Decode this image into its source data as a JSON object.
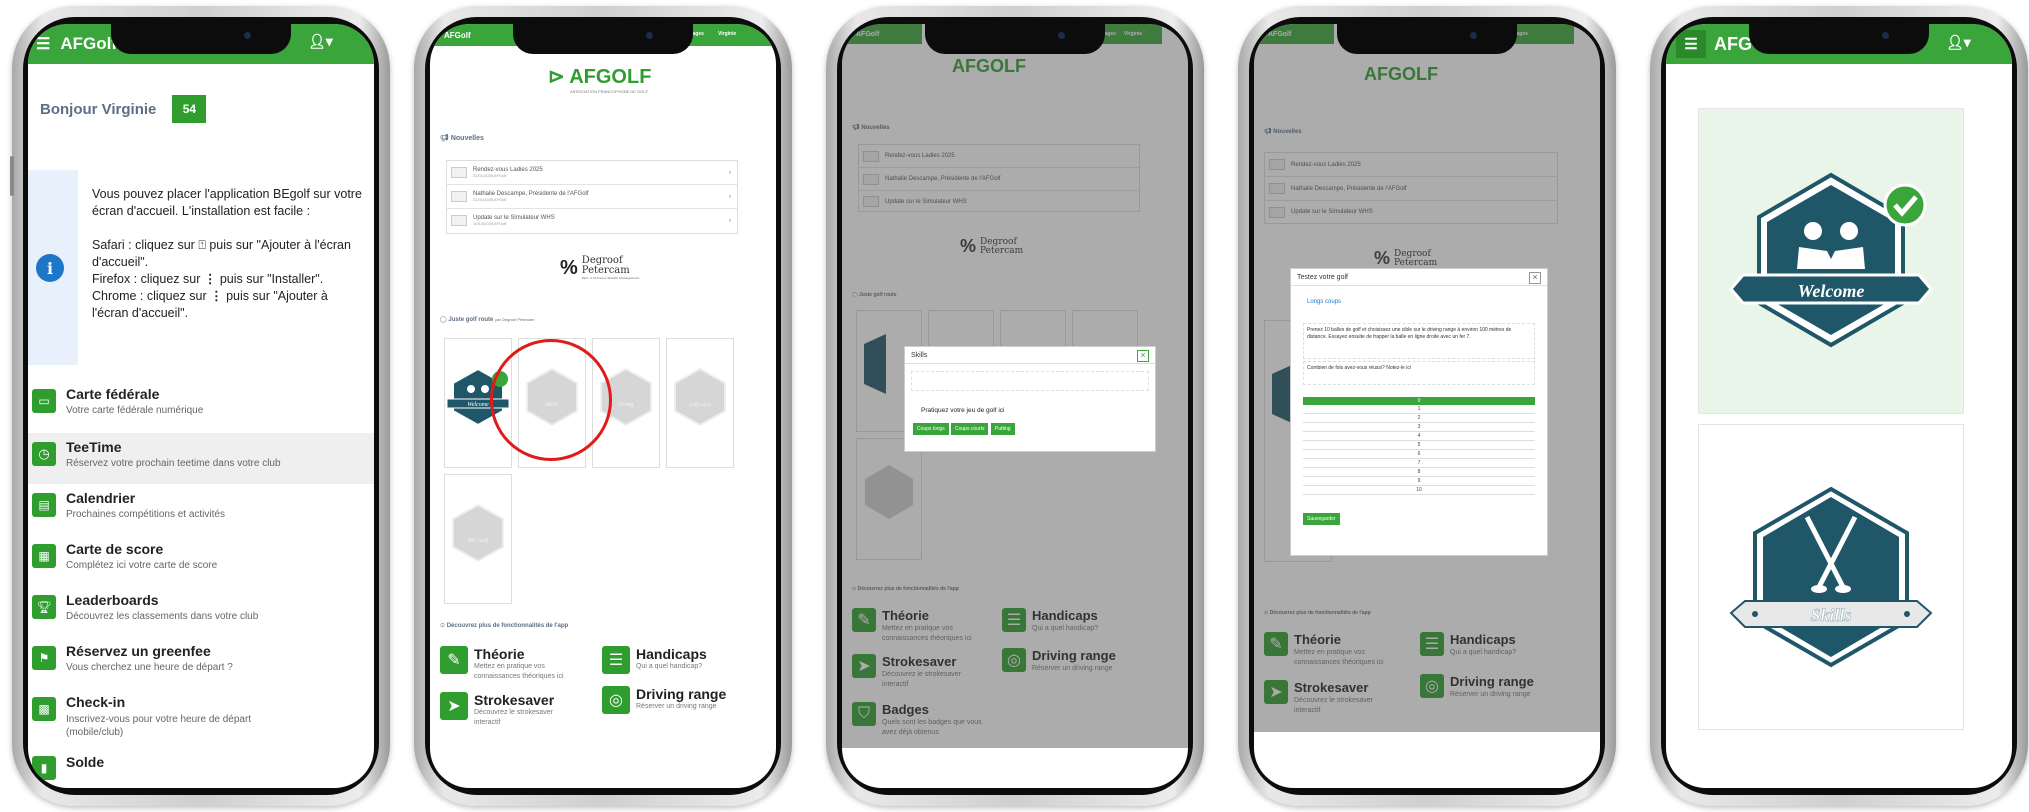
{
  "screen1": {
    "app_name": "AFGolf",
    "greeting": "Bonjour Virginie",
    "badge_number": "54",
    "info_text": [
      "Vous pouvez placer l'application BEgolf sur votre écran d'accueil. L'installation est facile :",
      "Safari : cliquez sur",
      "puis sur \"Ajouter à l'écran d'accueil\".",
      "Firefox : cliquez sur",
      "puis sur \"Installer\".",
      "Chrome : cliquez sur",
      "puis sur \"Ajouter à l'écran d'accueil\"."
    ],
    "menu": [
      {
        "title": "Carte fédérale",
        "subtitle": "Votre carte fédérale numérique",
        "icon": "id-card-icon"
      },
      {
        "title": "TeeTime",
        "subtitle": "Réservez votre prochain teetime dans votre club",
        "icon": "clock-icon"
      },
      {
        "title": "Calendrier",
        "subtitle": "Prochaines compétitions et activités",
        "icon": "calendar-icon"
      },
      {
        "title": "Carte de score",
        "subtitle": "Complétez ici votre carte de score",
        "icon": "scorecard-icon"
      },
      {
        "title": "Leaderboards",
        "subtitle": "Découvrez les classements dans votre club",
        "icon": "trophy-icon"
      },
      {
        "title": "Réservez un greenfee",
        "subtitle": "Vous cherchez une heure de départ ?",
        "icon": "flag-icon"
      },
      {
        "title": "Check-in",
        "subtitle": "Inscrivez-vous pour votre heure de départ (mobile/club)",
        "icon": "qr-icon"
      },
      {
        "title": "Solde",
        "subtitle": "",
        "icon": "wallet-icon"
      }
    ]
  },
  "screen2": {
    "header_brand": "AFGolf",
    "header_links": [
      "Messages",
      "Virginie"
    ],
    "logo_text": "AFGOLF",
    "logo_tagline": "ASSOCIATION FRANCOPHONE DE GOLF",
    "news_heading": "Nouvelles",
    "news": [
      {
        "title": "Rendez-vous Ladies 2025",
        "meta": "21/01/2025 AFGolf"
      },
      {
        "title": "Nathalie Descampe, Présidente de l'AFGolf",
        "meta": "21/01/2025 AFGolf"
      },
      {
        "title": "Update sur le Simulateur WHS",
        "meta": "10/10/2024 AFGolf"
      }
    ],
    "sponsor_name": [
      "Degroof",
      "Petercam"
    ],
    "sponsor_tagline": "Part of Indosuez Wealth Management",
    "badges_heading": "Juste golf route",
    "badges_sub": "par Degroof Petercam",
    "badges": [
      "Welcome",
      "Skills",
      "Swing",
      "Golfcourse",
      "Bel Golf"
    ],
    "discover_heading": "Découvrez plus de fonctionnalités de l'app",
    "features": [
      {
        "title": "Théorie",
        "desc": "Mettez en pratique vos connaissances théoriques ici"
      },
      {
        "title": "Handicaps",
        "desc": "Qui a quel handicap?"
      },
      {
        "title": "Strokesaver",
        "desc": "Découvrez le strokesaver interactif"
      },
      {
        "title": "Driving range",
        "desc": "Réserver un driving range"
      }
    ]
  },
  "screen3": {
    "modal_title": "Skills",
    "modal_close": "×",
    "modal_text": "Pratiquez votre jeu de golf ici",
    "modal_buttons": [
      "Coups longs",
      "Coups courts",
      "Putting"
    ],
    "features": [
      {
        "title": "Théorie",
        "desc": "Mettez en pratique vos connaissances théoriques ici"
      },
      {
        "title": "Handicaps",
        "desc": "Qui a quel handicap?"
      },
      {
        "title": "Strokesaver",
        "desc": "Découvrez le strokesaver interactif"
      },
      {
        "title": "Driving range",
        "desc": "Réserver un driving range"
      },
      {
        "title": "Badges",
        "desc": "Quels sont les badges que vous avez déjà obtenus"
      }
    ]
  },
  "screen4": {
    "modal_title": "Testez votre golf",
    "modal_close": "×",
    "section_title": "Longs coups",
    "instruction": "Prenez 10 balles de golf et choisissez une cible sur le driving range à environ 100 mètres de distance. Essayez ensuite de frapper la balle en ligne droite avec un fer 7.",
    "question": "Combien de fois avez-vous réussi? Notez-le ici",
    "options": [
      "0",
      "1",
      "2",
      "3",
      "4",
      "5",
      "6",
      "7",
      "8",
      "9",
      "10"
    ],
    "save_button": "Sauvegarder",
    "features": [
      {
        "title": "Théorie",
        "desc": "Mettez en pratique vos connaissances théoriques ici"
      },
      {
        "title": "Handicaps",
        "desc": "Qui a quel handicap?"
      },
      {
        "title": "Strokesaver",
        "desc": "Découvrez le strokesaver interactif"
      },
      {
        "title": "Driving range",
        "desc": "Réserver un driving range"
      }
    ]
  },
  "screen5": {
    "app_name": "AFG",
    "badge1_label": "Welcome",
    "badge2_label": "Skills"
  },
  "colors": {
    "brand_green": "#3aa53a",
    "badge_navy": "#1f5668",
    "highlight_red": "#e01b1b"
  }
}
